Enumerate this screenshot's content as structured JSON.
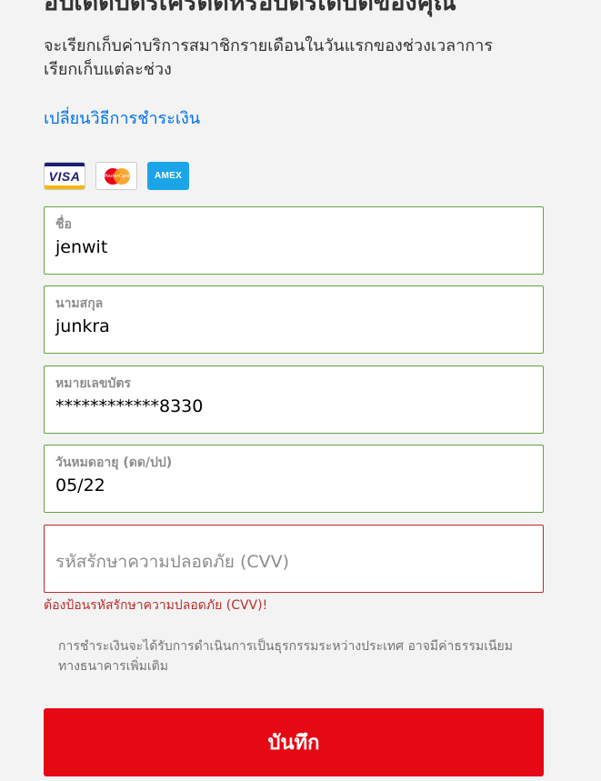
{
  "header": {
    "title": "อัปเดตบัตรเครดิตหรือบัตรเดบิตของคุณ",
    "subtitle": "จะเรียกเก็บค่าบริการสมาชิกรายเดือนในวันแรกของช่วงเวลาการเรียกเก็บแต่ละช่วง"
  },
  "change_method_link": "เปลี่ยนวิธีการชำระเงิน",
  "cards": {
    "visa": "VISA",
    "mastercard": "MasterCard",
    "amex": "AMEX"
  },
  "form": {
    "first_name": {
      "label": "ชื่อ",
      "value": "jenwit"
    },
    "last_name": {
      "label": "นามสกุล",
      "value": "junkra"
    },
    "card_number": {
      "label": "หมายเลขบัตร",
      "value": "************8330"
    },
    "expiry": {
      "label": "วันหมดอายุ (ดด/ปป)",
      "value": "05/22"
    },
    "cvv": {
      "placeholder": "รหัสรักษาความปลอดภัย (CVV)",
      "error": "ต้องป้อนรหัสรักษาความปลอดภัย (CVV)!"
    }
  },
  "disclaimer": "การชำระเงินจะได้รับการดำเนินการเป็นธุรกรรมระหว่างประเทศ อาจมีค่าธรรมเนียมทางธนาคารเพิ่มเติม",
  "save_button": "บันทึก",
  "colors": {
    "accent_red": "#e50914",
    "link_blue": "#0071eb",
    "valid_green": "#5fa53f",
    "error_red": "#b92d2b",
    "amex_blue": "#1ba5e8"
  }
}
